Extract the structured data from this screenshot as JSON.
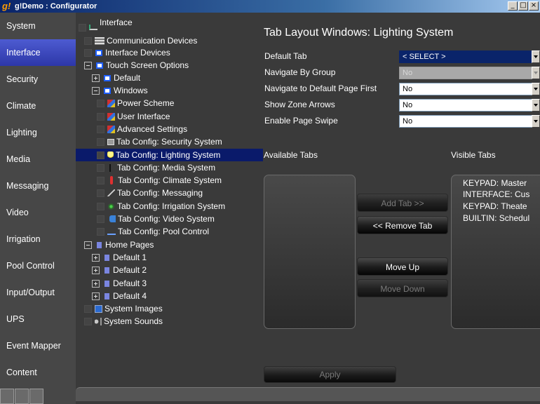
{
  "window": {
    "app_icon": "g!",
    "title": "g!Demo : Configurator",
    "buttons": [
      "_",
      "□",
      "×"
    ]
  },
  "nav": {
    "items": [
      {
        "label": "System"
      },
      {
        "label": "Interface",
        "active": true
      },
      {
        "label": "Security"
      },
      {
        "label": "Climate"
      },
      {
        "label": "Lighting"
      },
      {
        "label": "Media"
      },
      {
        "label": "Messaging"
      },
      {
        "label": "Video"
      },
      {
        "label": "Irrigation"
      },
      {
        "label": "Pool Control"
      },
      {
        "label": "Input/Output"
      },
      {
        "label": "UPS"
      },
      {
        "label": "Event Mapper"
      },
      {
        "label": "Content"
      }
    ]
  },
  "tree": {
    "items": [
      {
        "label": "Interface",
        "icon": "link-icon"
      },
      {
        "label": "Communication Devices",
        "icon": "communication-icon"
      },
      {
        "label": "Interface Devices",
        "icon": "screen-icon"
      },
      {
        "label": "Touch Screen Options",
        "icon": "screen-icon"
      },
      {
        "label": "Default",
        "icon": "screen-icon"
      },
      {
        "label": "Windows",
        "icon": "screen-icon"
      },
      {
        "label": "Power Scheme",
        "icon": "window-scheme-icon"
      },
      {
        "label": "User Interface",
        "icon": "window-scheme-icon"
      },
      {
        "label": "Advanced Settings",
        "icon": "window-scheme-icon"
      },
      {
        "label": "Tab Config: Security System",
        "icon": "security-icon"
      },
      {
        "label": "Tab Config: Lighting System",
        "icon": "bulb-icon",
        "selected": true
      },
      {
        "label": "Tab Config: Media System",
        "icon": "music-note-icon"
      },
      {
        "label": "Tab Config: Climate System",
        "icon": "thermometer-icon"
      },
      {
        "label": "Tab Config: Messaging",
        "icon": "messaging-icon"
      },
      {
        "label": "Tab Config: Irrigation System",
        "icon": "sprinkler-icon"
      },
      {
        "label": "Tab Config: Video System",
        "icon": "video-icon"
      },
      {
        "label": "Tab Config: Pool Control",
        "icon": "pool-icon"
      },
      {
        "label": "Home Pages",
        "icon": "home-page-icon"
      },
      {
        "label": "Default 1",
        "icon": "home-page-icon"
      },
      {
        "label": "Default 2",
        "icon": "home-page-icon"
      },
      {
        "label": "Default 3",
        "icon": "home-page-icon"
      },
      {
        "label": "Default 4",
        "icon": "home-page-icon"
      },
      {
        "label": "System Images",
        "icon": "image-icon"
      },
      {
        "label": "System Sounds",
        "icon": "sound-icon"
      }
    ]
  },
  "panel": {
    "title": "Tab Layout Windows: Lighting System",
    "fields": [
      {
        "label": "Default Tab",
        "value": "< SELECT >",
        "state": "highlight"
      },
      {
        "label": "Navigate By Group",
        "value": "No",
        "state": "disabled"
      },
      {
        "label": "Navigate to Default Page First",
        "value": "No",
        "state": "normal"
      },
      {
        "label": "Show Zone Arrows",
        "value": "No",
        "state": "normal"
      },
      {
        "label": "Enable Page Swipe",
        "value": "No",
        "state": "normal"
      }
    ],
    "available_tabs_label": "Available Tabs",
    "visible_tabs_label": "Visible Tabs",
    "visible_tabs": [
      "KEYPAD: Master",
      "INTERFACE: Cus",
      "KEYPAD: Theate",
      "BUILTIN: Schedul"
    ],
    "buttons": {
      "add_tab": "Add Tab >>",
      "remove_tab": "<< Remove Tab",
      "move_up": "Move Up",
      "move_down": "Move Down",
      "apply": "Apply"
    }
  }
}
